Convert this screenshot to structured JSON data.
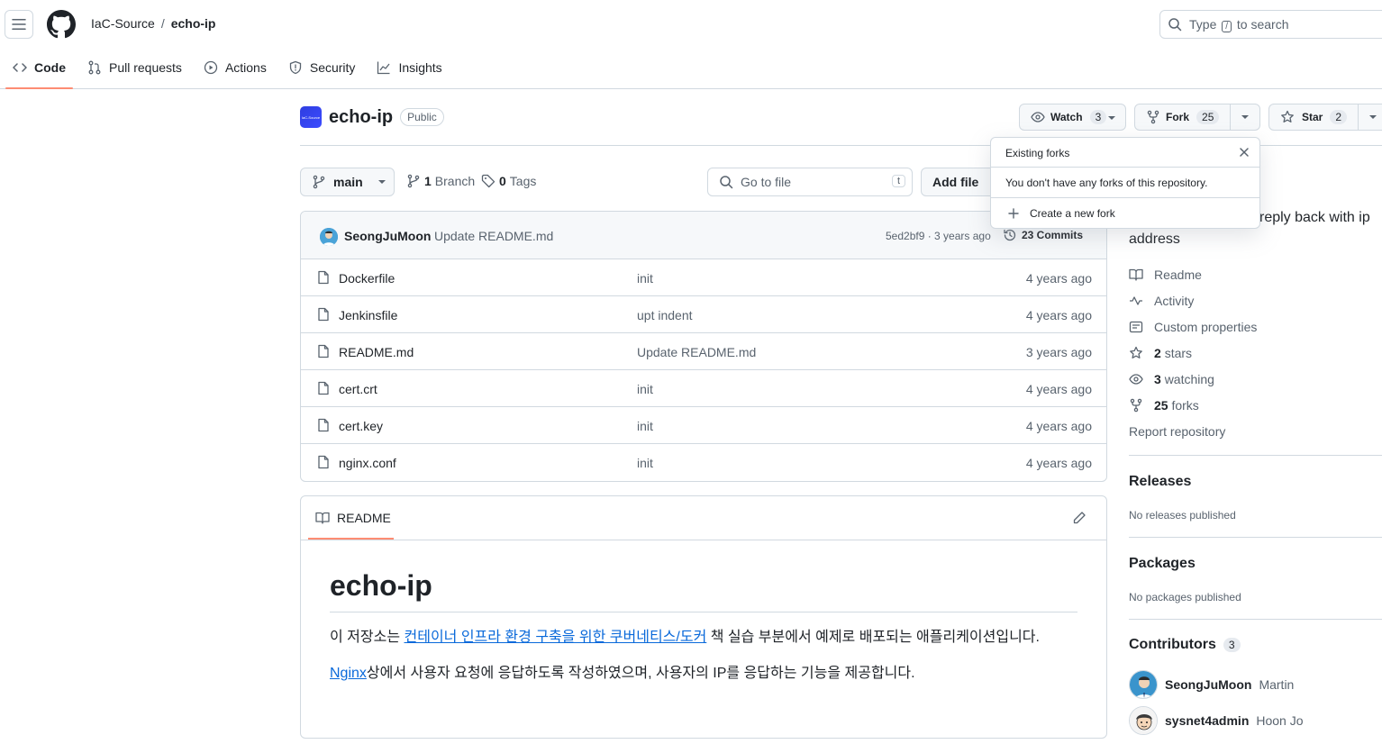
{
  "header": {
    "owner": "IaC-Source",
    "separator": "/",
    "repo": "echo-ip",
    "search_prefix": "Type",
    "search_key": "/",
    "search_suffix": "to search"
  },
  "tabs": [
    {
      "label": "Code",
      "icon": "code-icon"
    },
    {
      "label": "Pull requests",
      "icon": "git-pull-request-icon"
    },
    {
      "label": "Actions",
      "icon": "play-icon"
    },
    {
      "label": "Security",
      "icon": "shield-icon"
    },
    {
      "label": "Insights",
      "icon": "graph-icon"
    }
  ],
  "repo": {
    "name": "echo-ip",
    "visibility": "Public",
    "avatar_text": "IaC-Source",
    "watch_label": "Watch",
    "watch_count": "3",
    "fork_label": "Fork",
    "fork_count": "25",
    "star_label": "Star",
    "star_count": "2"
  },
  "filenav": {
    "branch": "main",
    "branch_count": "1",
    "branch_word": "Branch",
    "tag_count": "0",
    "tag_word": "Tags",
    "goto_placeholder": "Go to file",
    "goto_key": "t",
    "add_file": "Add file"
  },
  "latest_commit": {
    "author": "SeongJuMoon",
    "message": "Update README.md",
    "hash_time": "5ed2bf9 · 3 years ago",
    "commits": "23 Commits"
  },
  "files": [
    {
      "name": "Dockerfile",
      "message": "init",
      "age": "4 years ago"
    },
    {
      "name": "Jenkinsfile",
      "message": "upt indent",
      "age": "4 years ago"
    },
    {
      "name": "README.md",
      "message": "Update README.md",
      "age": "3 years ago"
    },
    {
      "name": "cert.crt",
      "message": "init",
      "age": "4 years ago"
    },
    {
      "name": "cert.key",
      "message": "init",
      "age": "4 years ago"
    },
    {
      "name": "nginx.conf",
      "message": "init",
      "age": "4 years ago"
    }
  ],
  "readme": {
    "tab": "README",
    "h1": "echo-ip",
    "p1_before": "이 저장소는 ",
    "p1_link": "컨테이너 인프라 환경 구축을 위한 쿠버네티스/도커",
    "p1_after": " 책 실습 부분에서 예제로 배포되는 애플리케이션입니다.",
    "p2_link": "Nginx",
    "p2_after": "상에서 사용자 요청에 응답하도록 작성하였으며, 사용자의 IP를 응답하는 기능을 제공합니다."
  },
  "about": {
    "desc_line1": "reply back with ip",
    "desc_line2": "address",
    "items": [
      {
        "icon": "book-icon",
        "label": "Readme"
      },
      {
        "icon": "pulse-icon",
        "label": "Activity"
      },
      {
        "icon": "note-icon",
        "label": "Custom properties"
      },
      {
        "icon": "star-icon",
        "count": "2",
        "label": "stars"
      },
      {
        "icon": "eye-icon",
        "count": "3",
        "label": "watching"
      },
      {
        "icon": "repo-forked-icon",
        "count": "25",
        "label": "forks"
      }
    ],
    "report": "Report repository"
  },
  "releases": {
    "title": "Releases",
    "empty": "No releases published"
  },
  "packages": {
    "title": "Packages",
    "empty": "No packages published"
  },
  "contributors": {
    "title": "Contributors",
    "count": "3",
    "list": [
      {
        "login": "SeongJuMoon",
        "name": "Martin"
      },
      {
        "login": "sysnet4admin",
        "name": "Hoon Jo"
      }
    ]
  },
  "fork_popover": {
    "title": "Existing forks",
    "message": "You don't have any forks of this repository.",
    "create": "Create a new fork"
  },
  "colors": {
    "accent_underline": "#fd8c73",
    "link": "#0969da",
    "border": "#d1d9e0",
    "muted": "#59636e"
  }
}
